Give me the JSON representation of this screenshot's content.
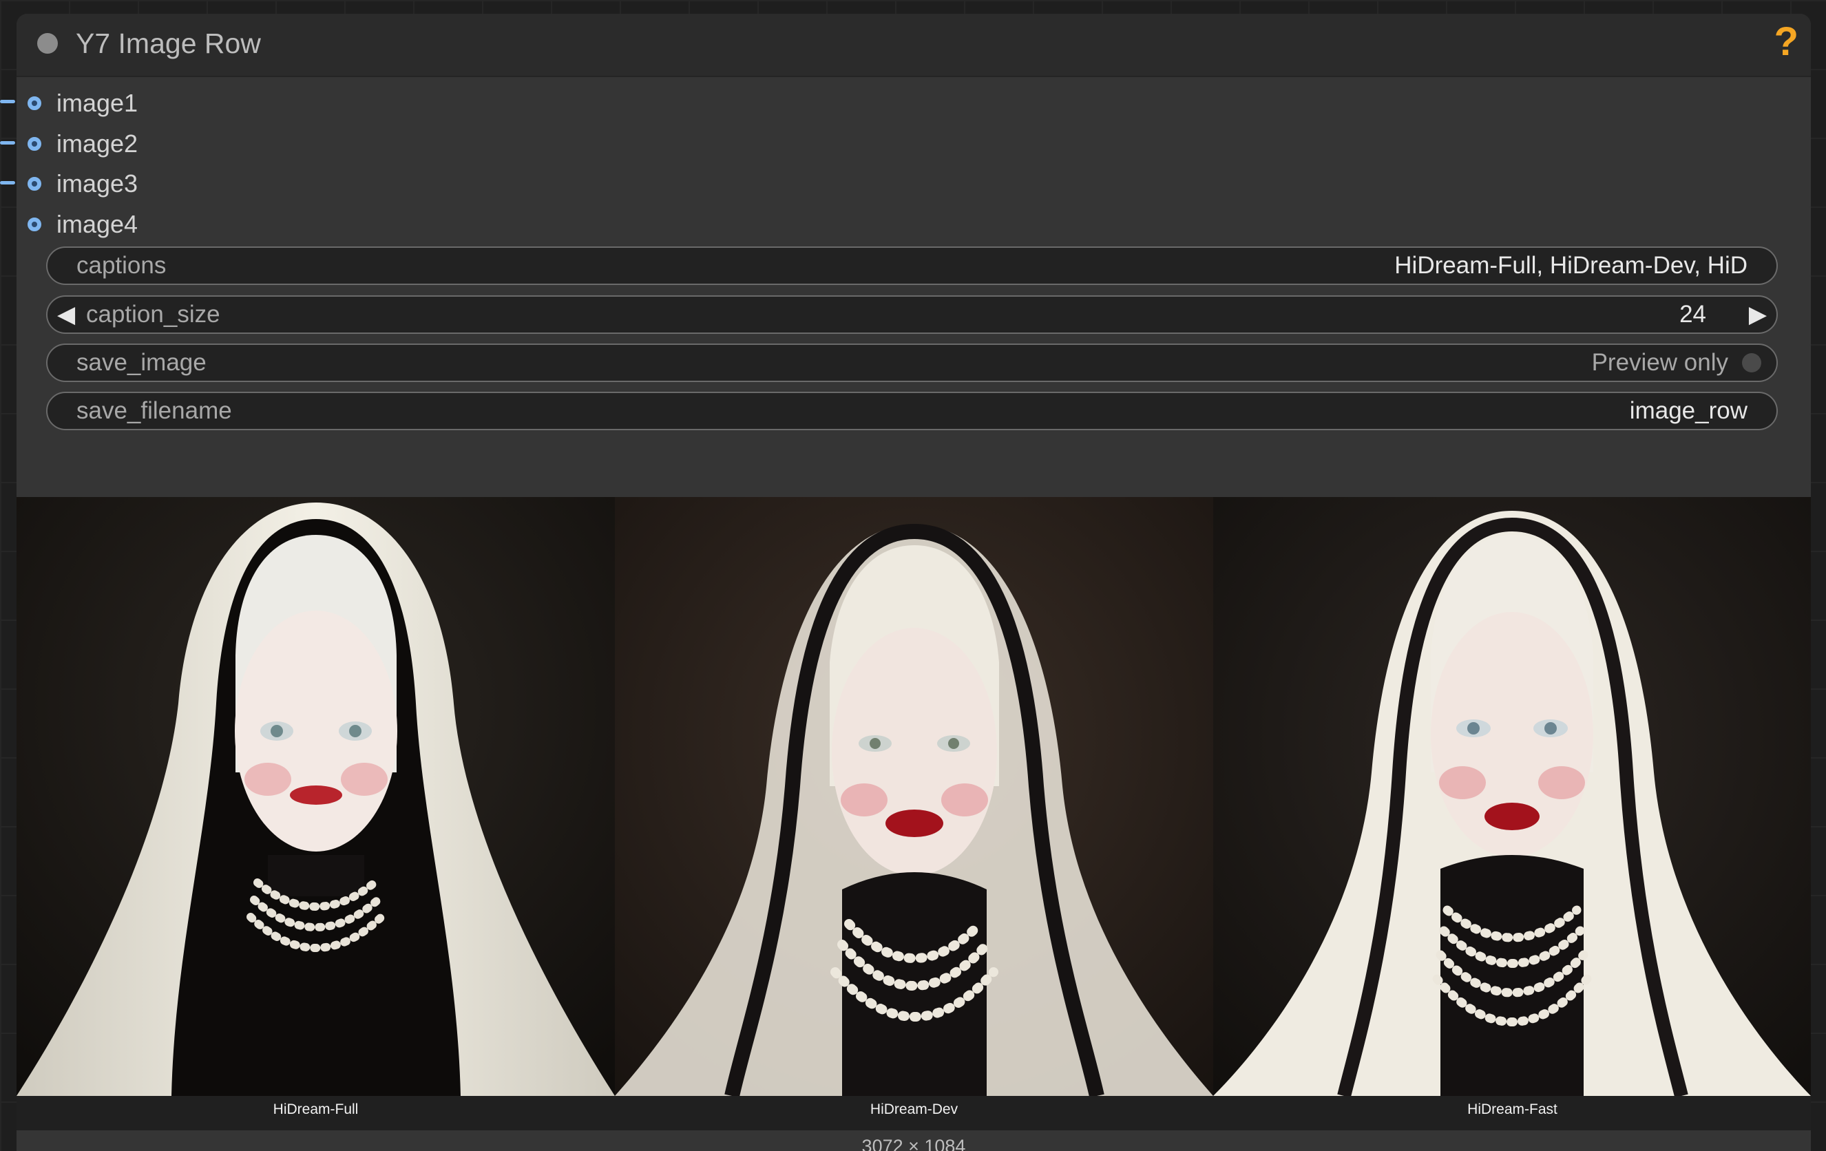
{
  "node": {
    "title": "Y7 Image Row",
    "help_label": "?"
  },
  "inputs": [
    "image1",
    "image2",
    "image3",
    "image4"
  ],
  "widgets": {
    "captions": {
      "label": "captions",
      "value": "HiDream-Full, HiDream-Dev, HiD"
    },
    "caption_size": {
      "label": "caption_size",
      "value": "24",
      "left_arrow": "◀",
      "right_arrow": "▶"
    },
    "save_image": {
      "label": "save_image",
      "value": "Preview only"
    },
    "save_filename": {
      "label": "save_filename",
      "value": "image_row"
    }
  },
  "images": [
    {
      "caption": "HiDream-Full"
    },
    {
      "caption": "HiDream-Dev"
    },
    {
      "caption": "HiDream-Fast"
    }
  ],
  "output_size": "3072 × 1084",
  "colors": {
    "slot_accent": "#7fb6f0",
    "help_accent": "#f5a623",
    "node_bg": "#353535"
  }
}
